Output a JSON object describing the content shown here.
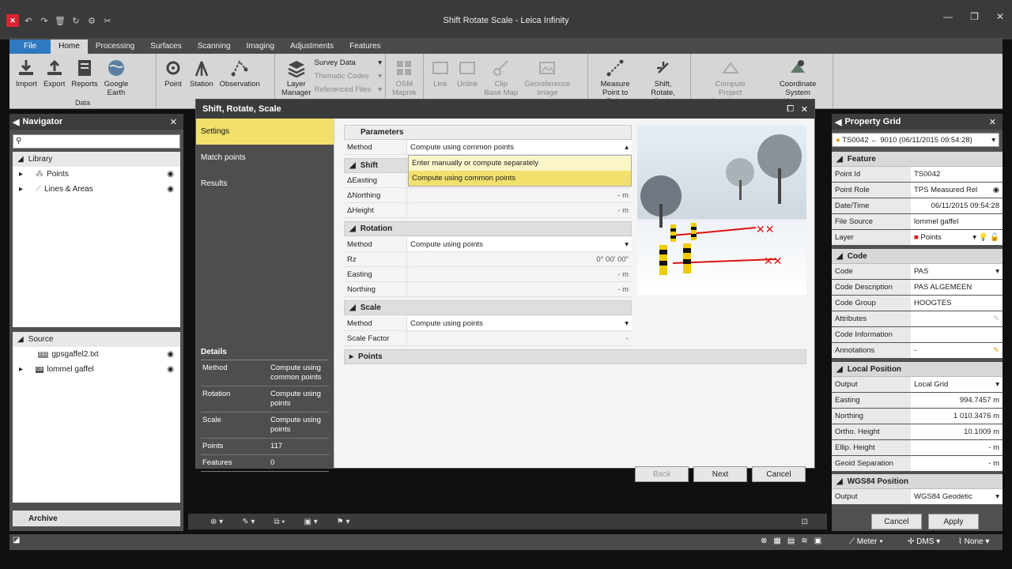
{
  "window": {
    "title": "Shift Rotate Scale - Leica Infinity"
  },
  "menu": {
    "tabs": [
      "File",
      "Home",
      "Processing",
      "Surfaces",
      "Scanning",
      "Imaging",
      "Adjustments",
      "Features"
    ],
    "active": "Home"
  },
  "ribbon": {
    "data_group": {
      "label": "Data",
      "buttons": [
        "Import",
        "Export",
        "Reports",
        "Google\nEarth"
      ]
    },
    "tools": [
      "Point",
      "Station",
      "Observation"
    ],
    "layer_manager": "Layer\nManager",
    "lists": [
      "Survey Data",
      "Thematic Codes",
      "Referenced Files"
    ],
    "osm": "OSM\nMapnik",
    "image_tools": [
      "Link",
      "Unlink",
      "Clip\nBase Map",
      "Georeference\nImage"
    ],
    "measure": "Measure\nPoint to Point",
    "shift": "Shift,\nRotate, Scale",
    "compute": "Compute\nProject Coordinates",
    "coord": "Coordinate\nSystem Manager"
  },
  "navigator": {
    "title": "Navigator",
    "library": {
      "label": "Library",
      "items": [
        "Points",
        "Lines & Areas"
      ]
    },
    "source": {
      "label": "Source",
      "items": [
        "gpsgaffel2.txt",
        "lommel gaffel"
      ]
    },
    "archive": "Archive"
  },
  "dialog": {
    "title": "Shift, Rotate, Scale",
    "steps": [
      "Settings",
      "Match points",
      "Results"
    ],
    "details": {
      "title": "Details",
      "rows": [
        {
          "k": "Method",
          "v": "Compute using common points"
        },
        {
          "k": "Rotation",
          "v": "Compute using points"
        },
        {
          "k": "Scale",
          "v": "Compute using points"
        },
        {
          "k": "Points",
          "v": "117"
        },
        {
          "k": "Features",
          "v": "0"
        }
      ]
    },
    "parameters": {
      "label": "Parameters",
      "method_label": "Method",
      "method_value": "Compute using common points"
    },
    "dropdown_options": [
      "Enter manually or compute separately",
      "Compute using common points"
    ],
    "shift": {
      "label": "Shift",
      "rows": [
        {
          "k": "ΔEasting",
          "v": "- m"
        },
        {
          "k": "ΔNorthing",
          "v": "- m"
        },
        {
          "k": "ΔHeight",
          "v": "- m"
        }
      ]
    },
    "rotation": {
      "label": "Rotation",
      "method": "Compute using points",
      "rows": [
        {
          "k": "Rz",
          "v": "0° 00' 00\""
        },
        {
          "k": "Easting",
          "v": "- m"
        },
        {
          "k": "Northing",
          "v": "- m"
        }
      ]
    },
    "scale": {
      "label": "Scale",
      "method": "Compute using points",
      "factor_label": "Scale Factor",
      "factor_value": "-"
    },
    "points_label": "Points",
    "buttons": {
      "back": "Back",
      "next": "Next",
      "cancel": "Cancel"
    }
  },
  "property_grid": {
    "title": "Property Grid",
    "selector": "TS0042 ← 9010 (06/11/2015 09:54:28)",
    "feature": {
      "label": "Feature",
      "rows": [
        {
          "k": "Point Id",
          "v": "TS0042"
        },
        {
          "k": "Point Role",
          "v": "TPS Measured Rel"
        },
        {
          "k": "Date/Time",
          "v": "06/11/2015 09:54:28"
        },
        {
          "k": "File Source",
          "v": "lommel gaffel"
        },
        {
          "k": "Layer",
          "v": "Points"
        }
      ]
    },
    "code": {
      "label": "Code",
      "rows": [
        {
          "k": "Code",
          "v": "PAS"
        },
        {
          "k": "Code Description",
          "v": "PAS ALGEMEEN"
        },
        {
          "k": "Code Group",
          "v": "HOOGTES"
        },
        {
          "k": "Attributes",
          "v": ""
        },
        {
          "k": "Code Information",
          "v": ""
        },
        {
          "k": "Annotations",
          "v": "-"
        }
      ]
    },
    "local": {
      "label": "Local Position",
      "rows": [
        {
          "k": "Output",
          "v": "Local Grid"
        },
        {
          "k": "Easting",
          "v": "994.7457  m"
        },
        {
          "k": "Northing",
          "v": "1 010.3476  m"
        },
        {
          "k": "Ortho. Height",
          "v": "10.1009  m"
        },
        {
          "k": "Ellip. Height",
          "v": "-  m"
        },
        {
          "k": "Geoid Separation",
          "v": "-  m"
        }
      ]
    },
    "wgs": {
      "label": "WGS84 Position",
      "rows": [
        {
          "k": "Output",
          "v": "WGS84 Geodetic"
        }
      ]
    },
    "buttons": {
      "cancel": "Cancel",
      "apply": "Apply"
    }
  },
  "status": {
    "unit": "Meter",
    "angle": "DMS",
    "snap": "None"
  }
}
